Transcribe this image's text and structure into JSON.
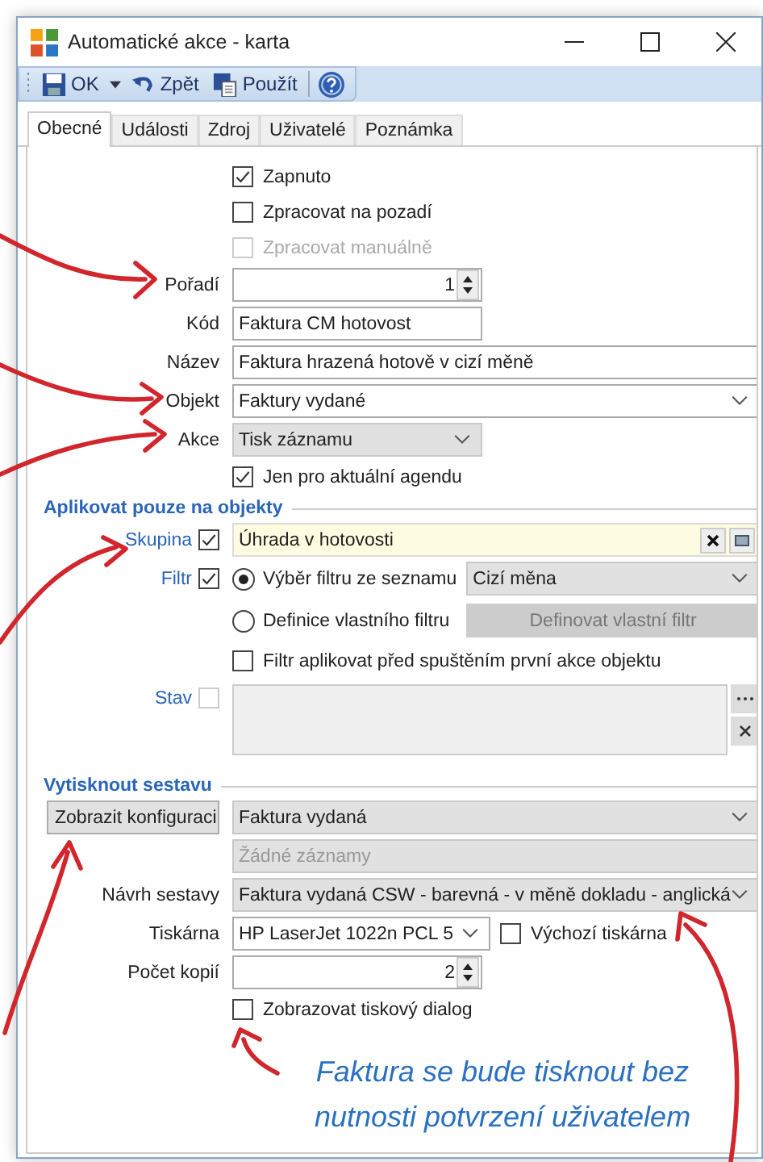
{
  "window": {
    "title": "Automatické akce - karta"
  },
  "toolbar": [
    {
      "kind": "save",
      "label": "OK"
    },
    {
      "kind": "dropdown"
    },
    {
      "kind": "undo",
      "label": "Zpět"
    },
    {
      "kind": "apply",
      "label": "Použít"
    },
    {
      "kind": "help"
    }
  ],
  "tabs": [
    {
      "label": "Obecné",
      "selected": true
    },
    {
      "label": "Události",
      "selected": false
    },
    {
      "label": "Zdroj",
      "selected": false
    },
    {
      "label": "Uživatelé",
      "selected": false
    },
    {
      "label": "Poznámka",
      "selected": false
    }
  ],
  "general": {
    "checks": [
      {
        "label": "Zapnuto",
        "checked": true,
        "disabled": false
      },
      {
        "label": "Zpracovat na pozadí",
        "checked": false,
        "disabled": false
      },
      {
        "label": "Zpracovat manuálně",
        "checked": false,
        "disabled": true
      }
    ],
    "order": {
      "label": "Pořadí",
      "value": "1"
    },
    "code": {
      "label": "Kód",
      "value": "Faktura CM hotovost"
    },
    "name": {
      "label": "Název",
      "value": "Faktura hrazená hotově v cizí měně"
    },
    "object": {
      "label": "Objekt",
      "value": "Faktury vydané"
    },
    "action": {
      "label": "Akce",
      "value": "Tisk záznamu"
    },
    "agenda_only": {
      "label": "Jen pro aktuální agendu",
      "checked": true
    }
  },
  "apply_section": {
    "title": "Aplikovat pouze na objekty",
    "group": {
      "label": "Skupina",
      "checked": true,
      "value": "Úhrada v hotovosti"
    },
    "filter": {
      "label": "Filtr",
      "checked": true,
      "options": [
        {
          "label": "Výběr filtru ze seznamu",
          "selected": true
        },
        {
          "label": "Definice vlastního filtru",
          "selected": false
        }
      ],
      "list_value": "Cizí měna",
      "define_button": "Definovat vlastní filtr",
      "apply_first": {
        "label": "Filtr aplikovat před spuštěním první akce objektu",
        "checked": false
      }
    },
    "state": {
      "label": "Stav",
      "checked": false
    }
  },
  "print_section": {
    "title": "Vytisknout sestavu",
    "config_button": "Zobrazit konfiguraci",
    "report": "Faktura vydaná",
    "records_placeholder": "Žádné záznamy",
    "design": {
      "label": "Návrh sestavy",
      "value": "Faktura vydaná CSW - barevná - v měně dokladu - anglická"
    },
    "printer": {
      "label": "Tiskárna",
      "value": "HP LaserJet 1022n PCL 5"
    },
    "default_printer": {
      "label": "Výchozí tiskárna",
      "checked": false
    },
    "copies": {
      "label": "Počet kopií",
      "value": "2"
    },
    "show_dialog": {
      "label": "Zobrazovat tiskový dialog",
      "checked": false
    }
  },
  "annotation": {
    "text": "Faktura se bude tisknout bez nutnosti potvrzení uživatelem"
  }
}
